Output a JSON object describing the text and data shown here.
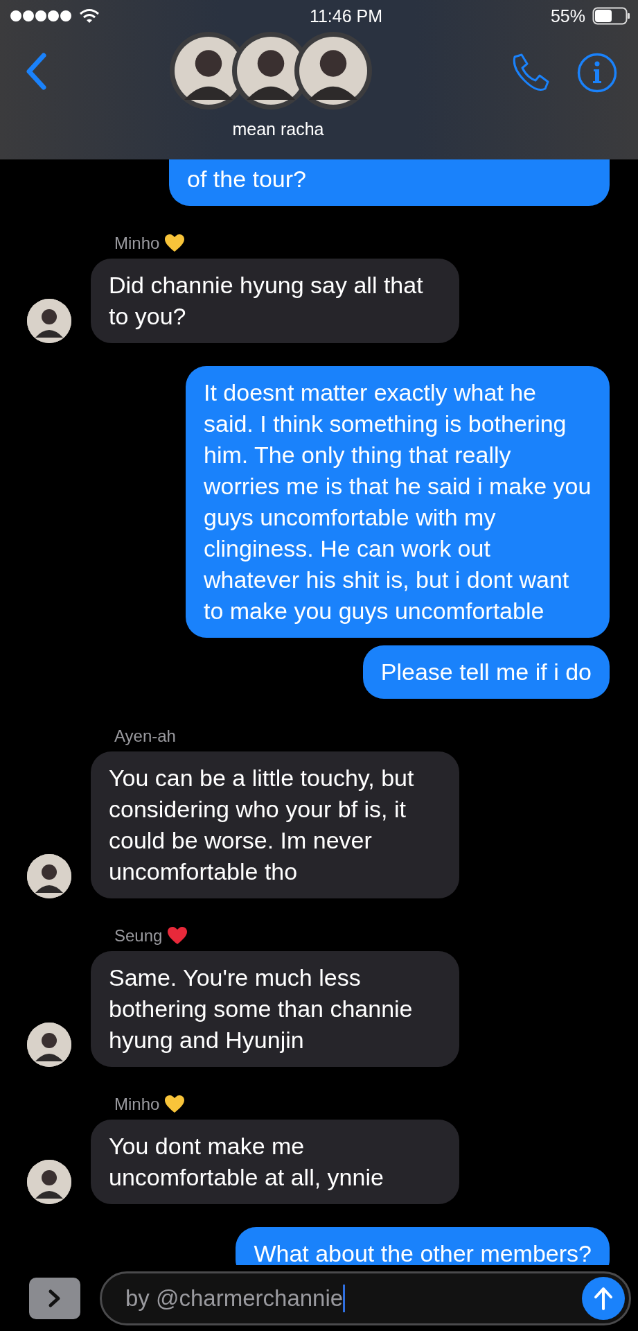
{
  "status_bar": {
    "time": "11:46 PM",
    "battery": "55%"
  },
  "header": {
    "title": "mean racha"
  },
  "messages": [
    {
      "kind": "sent",
      "text": "of the tour?"
    },
    {
      "kind": "received",
      "sender": "Minho",
      "color": "#f8c43a",
      "text": "Did channie hyung say all that to you?"
    },
    {
      "kind": "sent",
      "text": "It doesnt matter exactly what he said. I think something is bothering him. The only thing that really worries me is that he said i make you guys uncomfortable with my clinginess. He can work out whatever his shit is, but i dont want to make you guys uncomfortable"
    },
    {
      "kind": "sent",
      "text": "Please tell me if i do"
    },
    {
      "kind": "received",
      "sender": "Ayen-ah",
      "text": "You can be a little touchy, but considering who your bf is, it could be worse. Im never uncomfortable tho"
    },
    {
      "kind": "received",
      "sender": "Seung",
      "color": "#e8293a",
      "text": "Same. You're much less bothering some than channie hyung and Hyunjin"
    },
    {
      "kind": "received",
      "sender": "Minho",
      "color": "#f8c43a",
      "text": "You dont make me uncomfortable at all, ynnie"
    },
    {
      "kind": "sent",
      "text": "What about the other members?"
    }
  ],
  "composer": {
    "value": "by @charmerchannie"
  }
}
